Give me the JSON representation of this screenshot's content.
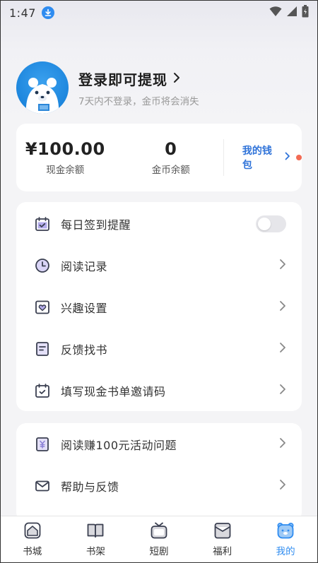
{
  "status_bar": {
    "time": "1:47"
  },
  "profile": {
    "title": "登录即可提现",
    "subtitle": "7天内不登录，金币将会消失"
  },
  "wallet": {
    "cash_value": "¥100.00",
    "cash_label": "现金余额",
    "coin_value": "0",
    "coin_label": "金币余额",
    "link_label": "我的钱包"
  },
  "menu": [
    {
      "label": "每日签到提醒",
      "icon": "calendar-check-icon",
      "type": "toggle",
      "on": false
    },
    {
      "label": "阅读记录",
      "icon": "clock-icon",
      "type": "link"
    },
    {
      "label": "兴趣设置",
      "icon": "heart-frame-icon",
      "type": "link"
    },
    {
      "label": "反馈找书",
      "icon": "note-icon",
      "type": "link"
    },
    {
      "label": "填写现金书单邀请码",
      "icon": "calendar-check-icon",
      "type": "link"
    }
  ],
  "menu2": [
    {
      "label": "阅读赚100元活动问题",
      "icon": "yuan-doc-icon",
      "type": "link"
    },
    {
      "label": "帮助与反馈",
      "icon": "mail-icon",
      "type": "link"
    }
  ],
  "bottom_nav": [
    {
      "label": "书城",
      "icon": "home-icon",
      "active": false
    },
    {
      "label": "书架",
      "icon": "book-icon",
      "active": false
    },
    {
      "label": "短剧",
      "icon": "tv-icon",
      "active": false
    },
    {
      "label": "福利",
      "icon": "gift-envelope-icon",
      "active": false
    },
    {
      "label": "我的",
      "icon": "bear-icon",
      "active": true
    }
  ],
  "colors": {
    "accent": "#2f8cf0",
    "link": "#2f73d9",
    "red_dot": "#f36b54",
    "icon_purple": "#8a7fd6"
  }
}
